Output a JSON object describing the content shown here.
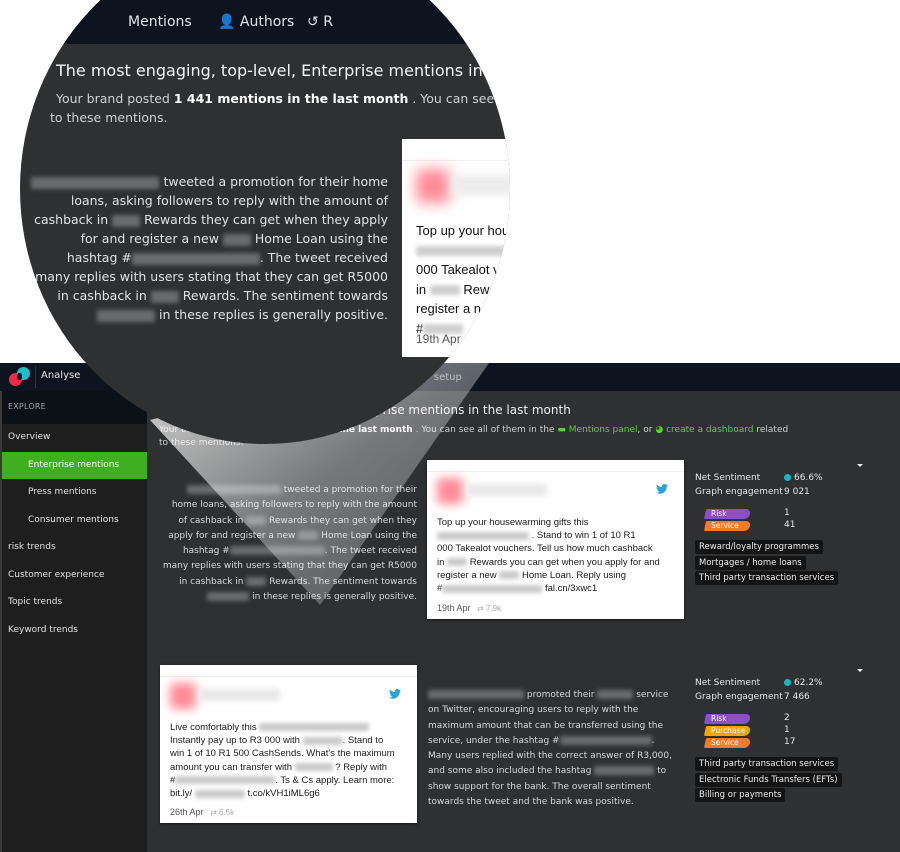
{
  "topbar": {
    "app_name": "Analyse",
    "setup_label": "setup",
    "magnified_nav": {
      "mentions_label": "Mentions",
      "authors_label": "Authors",
      "third_label": "R"
    }
  },
  "sidebar": {
    "section_label": "EXPLORE",
    "items": [
      {
        "label": "Overview",
        "sub": false,
        "active": false
      },
      {
        "label": "Enterprise mentions",
        "sub": true,
        "active": true
      },
      {
        "label": "Press mentions",
        "sub": true,
        "active": false
      },
      {
        "label": "Consumer mentions",
        "sub": true,
        "active": false
      },
      {
        "label": "risk trends",
        "sub": false,
        "active": false
      },
      {
        "label": "Customer experience",
        "sub": false,
        "active": false
      },
      {
        "label": "Topic trends",
        "sub": false,
        "active": false
      },
      {
        "label": "Keyword trends",
        "sub": false,
        "active": false
      }
    ]
  },
  "header": {
    "headline": "The most engaging, top-level, Enterprise mentions in the last month",
    "intro_prefix": "Your brand posted",
    "mention_count": "1 441 mentions in the last month",
    "intro_mid": ". You can see all of them in the",
    "mentions_panel_link": "Mentions panel",
    "or_text": ", or",
    "dashboard_link": "create a dashboard",
    "related_text": "related",
    "second_line": "to these mentions."
  },
  "colors": {
    "accent_green": "#3fae1f",
    "link_green": "#58d337",
    "sentiment_dot": "#15b8c5",
    "risk": "#8e4ec6",
    "service": "#f47a2c",
    "purchase": "#f6a500",
    "twitter": "#1da1f2"
  },
  "mentions": [
    {
      "summary": {
        "before_1": "tweeted a promotion for their home loans, asking followers to reply with the amount of cashback in",
        "before_2": "Rewards they can get when they apply for and register a new",
        "before_3": "Home Loan using the hashtag #",
        "before_4": ". The tweet received many replies with users stating that they can get R5000 in cashback in",
        "before_5": "Rewards. The sentiment towards",
        "before_6": "in these replies is generally positive."
      },
      "tweet": {
        "line1": "Top up your housewarming gifts this",
        "line2": ". Stand to win 1 of 10 R1",
        "line3": "000 Takealot vouchers. Tell us how much cashback",
        "line4a": "in",
        "line4b": "Rewards you can get when you apply for and",
        "line5a": "register a new",
        "line5b": "Home Loan. Reply using",
        "line6a": "#",
        "line6b": "fal.cn/3xwc1",
        "date": "19th Apr",
        "engagement": "7.9k",
        "network_icon": "twitter-icon"
      },
      "stats": {
        "net_sentiment_label": "Net Sentiment",
        "net_sentiment_value": "66.6%",
        "engagement_label": "Graph engagement",
        "engagement_value": "9 021",
        "tags": [
          {
            "label": "Risk",
            "count": "1",
            "color": "#8e4ec6"
          },
          {
            "label": "Service",
            "count": "41",
            "color": "#f47a2c"
          }
        ],
        "categories": [
          "Reward/loyalty programmes",
          "Mortgages / home loans",
          "Third party transaction services"
        ]
      }
    },
    {
      "summary": {
        "t1": "promoted their",
        "t2": "service on Twitter, encouraging users to reply with the maximum amount that can be transferred using the service, under the hashtag #",
        "t3": ". Many users replied with the correct answer of R3,000, and some also included the hashtag",
        "t4": "to show support for the bank. The overall sentiment towards the tweet and the bank was positive."
      },
      "tweet": {
        "line1": "Live comfortably this",
        "line2a": "Instantly pay up to R3 000 with",
        "line2b": ". Stand to",
        "line3": "win 1 of 10 R1 500 CashSends. What's the maximum",
        "line4a": "amount you can transfer with",
        "line4b": "? Reply with",
        "line5a": "#",
        "line5b": ". Ts & Cs apply. Learn more:",
        "line6a": "bit.ly/",
        "line6b": "t.co/kVH1iML6g6",
        "date": "26th Apr",
        "engagement": "6.5k",
        "network_icon": "twitter-icon"
      },
      "stats": {
        "net_sentiment_label": "Net Sentiment",
        "net_sentiment_value": "62.2%",
        "engagement_label": "Graph engagement",
        "engagement_value": "7 466",
        "tags": [
          {
            "label": "Risk",
            "count": "2",
            "color": "#8e4ec6"
          },
          {
            "label": "Purchase",
            "count": "1",
            "color": "#f6a500"
          },
          {
            "label": "Service",
            "count": "17",
            "color": "#f47a2c"
          }
        ],
        "categories": [
          "Third party transaction services",
          "Electronic Funds Transfers (EFTs)",
          "Billing or payments"
        ]
      }
    }
  ]
}
